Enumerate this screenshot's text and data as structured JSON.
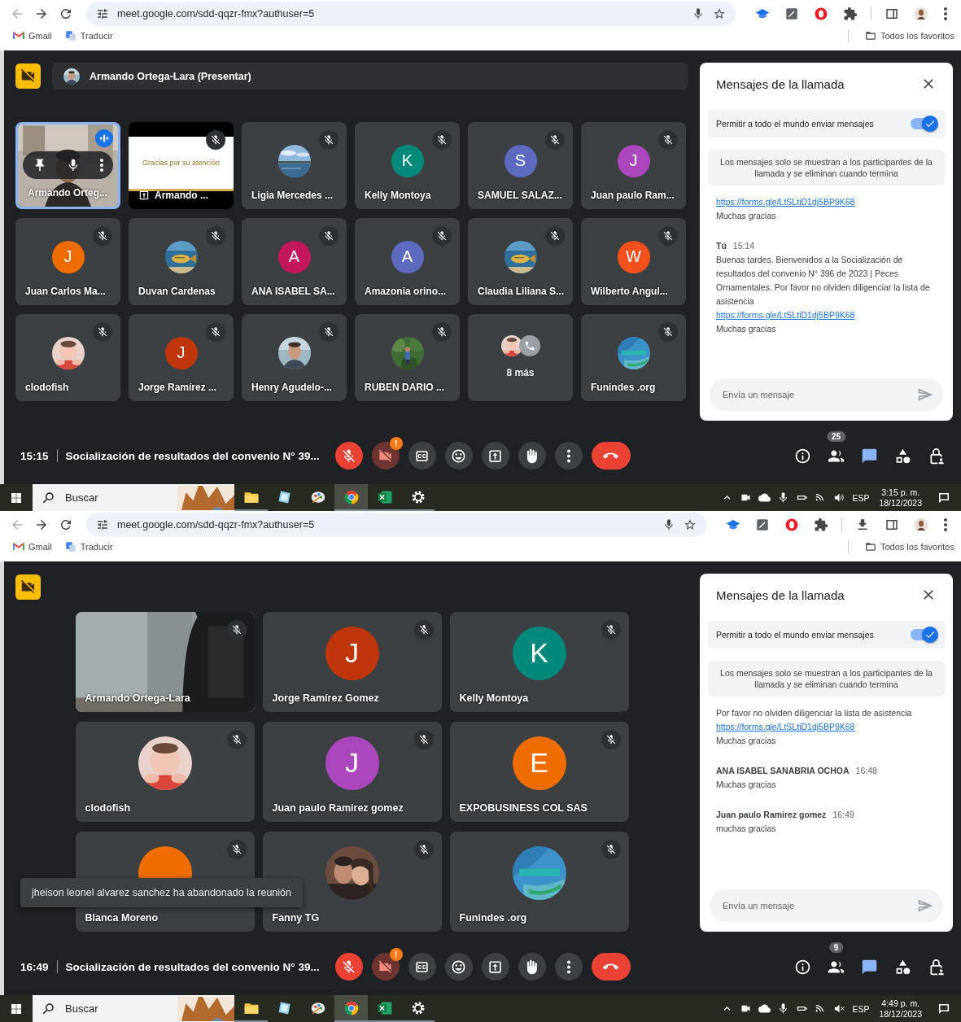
{
  "shots": [
    {
      "browser": {
        "url": "meet.google.com/sdd-qqzr-fmx?authuser=5",
        "download_shown": false,
        "bookmarks": [
          {
            "kind": "gmail",
            "label": "Gmail"
          },
          {
            "kind": "translate",
            "label": "Traducir"
          }
        ],
        "all_bookmarks": "Todos los favoritos"
      },
      "meet": {
        "presenter_bar": {
          "label": "Armando Ortega-Lara (Presentar)"
        },
        "tiles": [
          {
            "kind": "video",
            "name": "Armando Orteg...",
            "muted": false,
            "speaking": true,
            "hovered": true
          },
          {
            "kind": "presentation",
            "name": "Armando ...",
            "slide_text": "Gracias por su atención",
            "muted": true,
            "speaking": false,
            "hovered": false
          },
          {
            "name": "Ligia Mercedes ...",
            "muted": true,
            "speaking": false,
            "hovered": false
          },
          {
            "kind": "avatar",
            "name": "Kelly Montoya",
            "letter": "K",
            "color": "#00897b",
            "muted": true,
            "speaking": false,
            "hovered": false
          },
          {
            "kind": "avatar",
            "name": "SAMUEL SALAZ...",
            "letter": "S",
            "color": "#5c6bc0",
            "muted": true,
            "speaking": false,
            "hovered": false
          },
          {
            "kind": "avatar",
            "name": "Juan paulo Ram...",
            "letter": "J",
            "color": "#ab47bc",
            "muted": true,
            "speaking": false,
            "hovered": false
          },
          {
            "kind": "avatar",
            "name": "Juan Carlos Ma...",
            "letter": "J",
            "color": "#ef6c00",
            "muted": true,
            "speaking": false,
            "hovered": false
          },
          {
            "name": "Duvan Cardenas",
            "muted": true,
            "speaking": false,
            "hovered": false
          },
          {
            "kind": "avatar",
            "name": "ANA ISABEL SA...",
            "letter": "A",
            "color": "#c2185b",
            "muted": true,
            "speaking": false,
            "hovered": false
          },
          {
            "kind": "avatar",
            "name": "Amazonia orino...",
            "letter": "A",
            "color": "#5c6bc0",
            "muted": true,
            "speaking": false,
            "hovered": false
          },
          {
            "name": "Claudia Liliana S...",
            "muted": true,
            "speaking": false,
            "hovered": false
          },
          {
            "kind": "avatar",
            "name": "Wilberto Angul...",
            "letter": "W",
            "color": "#f4511e",
            "muted": true,
            "speaking": false,
            "hovered": false
          },
          {
            "name": "clodofish",
            "muted": true,
            "speaking": false,
            "hovered": false
          },
          {
            "kind": "avatar",
            "name": "Jorge Ramírez ...",
            "letter": "J",
            "color": "#bf360c",
            "muted": true,
            "speaking": false,
            "hovered": false
          },
          {
            "name": "Henry Agudelo-...",
            "muted": true,
            "speaking": false,
            "hovered": false
          },
          {
            "name": "RUBEN DARIO ...",
            "muted": true,
            "speaking": false,
            "hovered": false
          },
          {
            "kind": "more",
            "name": "8 más",
            "muted": false,
            "speaking": false,
            "hovered": false
          },
          {
            "name": "Funindes .org",
            "muted": true,
            "speaking": false,
            "hovered": false
          }
        ],
        "chat": {
          "title": "Mensajes de la llamada",
          "allow": {
            "label": "Permitir a todo el mundo enviar mensajes",
            "on": true
          },
          "notice": "Los mensajes solo se muestran a los participantes de la llamada y se eliminan cuando termina",
          "messages": [
            {
              "lines": [
                {
                  "kind": "link",
                  "text": "https://forms.gle/LtSLtiD1dj5BP9K68"
                },
                {
                  "kind": "text",
                  "text": "Muchas gracias"
                }
              ]
            },
            {
              "sender": "Tú",
              "time": "15:14",
              "lines": [
                {
                  "kind": "text",
                  "text": "Buenas tardes. Bienvenidos a la Socialización de resultados del convenio N° 396 de 2023 | Peces Ornamentales. Por favor no olviden diligenciar la lista de asistencia"
                },
                {
                  "kind": "link",
                  "text": "https://forms.gle/LtSLtiD1dj5BP9K68"
                },
                {
                  "kind": "text",
                  "text": "Muchas gracias"
                }
              ]
            }
          ],
          "input": {
            "placeholder": "Envía un mensaje"
          }
        },
        "controls": {
          "time": "15:15",
          "title": "Socialización de resultados del convenio N° 39...",
          "mic_on": false,
          "camera_on": false,
          "camera_alert": "!",
          "people_count": "25",
          "chat_open": true
        }
      },
      "taskbar": {
        "search": {
          "placeholder": "Buscar"
        },
        "apps": [
          {
            "kind": "folder",
            "running": true,
            "active": false
          },
          {
            "kind": "notes",
            "running": false,
            "active": false
          },
          {
            "kind": "paint",
            "running": false,
            "active": false
          },
          {
            "kind": "chrome",
            "running": true,
            "active": true
          },
          {
            "kind": "excel",
            "running": true,
            "active": false
          },
          {
            "kind": "settings",
            "running": true,
            "active": false
          }
        ],
        "language": "ESP",
        "time": "3:15 p. m.",
        "date": "18/12/2023",
        "volume_muted": false
      }
    },
    {
      "browser": {
        "url": "meet.google.com/sdd-qqzr-fmx?authuser=5",
        "download_shown": true,
        "bookmarks": [
          {
            "kind": "gmail",
            "label": "Gmail"
          },
          {
            "kind": "translate",
            "label": "Traducir"
          }
        ],
        "all_bookmarks": "Todos los favoritos"
      },
      "meet": {
        "tiles": [
          {
            "kind": "video",
            "name": "Armando Ortega-Lara",
            "muted": true,
            "speaking": false,
            "hovered": false
          },
          {
            "kind": "avatar",
            "name": "Jorge Ramírez Gomez",
            "letter": "J",
            "color": "#bf360c",
            "muted": true,
            "speaking": false,
            "hovered": false
          },
          {
            "kind": "avatar",
            "name": "Kelly Montoya",
            "letter": "K",
            "color": "#00897b",
            "muted": true,
            "speaking": false,
            "hovered": false
          },
          {
            "name": "clodofish",
            "muted": true,
            "speaking": false,
            "hovered": false
          },
          {
            "kind": "avatar",
            "name": "Juan paulo Ramirez gomez",
            "letter": "J",
            "color": "#ab47bc",
            "muted": true,
            "speaking": false,
            "hovered": false
          },
          {
            "kind": "avatar",
            "name": "EXPOBUSINESS COL SAS",
            "letter": "E",
            "color": "#ef6c00",
            "muted": true,
            "speaking": false,
            "hovered": false
          },
          {
            "kind": "avatar",
            "name": "Blanca Moreno",
            "color": "#ef6c00",
            "muted": true,
            "speaking": false,
            "hovered": false
          },
          {
            "name": "Fanny TG",
            "muted": true,
            "speaking": false,
            "hovered": false
          },
          {
            "name": "Funindes .org",
            "muted": true,
            "speaking": false,
            "hovered": false
          }
        ],
        "toast": "jheison leonel alvarez sanchez ha abandonado la reunión",
        "chat": {
          "title": "Mensajes de la llamada",
          "allow": {
            "label": "Permitir a todo el mundo enviar mensajes",
            "on": true
          },
          "notice": "Los mensajes solo se muestran a los participantes de la llamada y se eliminan cuando termina",
          "messages": [
            {
              "lines": [
                {
                  "kind": "text",
                  "text": "Por favor no olviden diligenciar la lista de asistencia"
                },
                {
                  "kind": "link",
                  "text": "https://forms.gle/LtSLtiD1dj5BP9K68"
                },
                {
                  "kind": "text",
                  "text": "Muchas gracias"
                }
              ]
            },
            {
              "sender": "ANA ISABEL SANABRIA OCHOA",
              "time": "16:48",
              "lines": [
                {
                  "kind": "text",
                  "text": "Muchas gracias"
                }
              ]
            },
            {
              "sender": "Juan paulo Ramirez gomez",
              "time": "16:49",
              "lines": [
                {
                  "kind": "text",
                  "text": "muchas gracias"
                }
              ]
            }
          ],
          "input": {
            "placeholder": "Envía un mensaje"
          }
        },
        "controls": {
          "time": "16:49",
          "title": "Socialización de resultados del convenio N° 39...",
          "mic_on": false,
          "camera_on": false,
          "camera_alert": "!",
          "people_count": "9",
          "chat_open": true
        }
      },
      "taskbar": {
        "search": {
          "placeholder": "Buscar"
        },
        "apps": [
          {
            "kind": "folder",
            "running": true,
            "active": false
          },
          {
            "kind": "notes",
            "running": false,
            "active": false
          },
          {
            "kind": "paint",
            "running": false,
            "active": false
          },
          {
            "kind": "chrome",
            "running": true,
            "active": true
          },
          {
            "kind": "excel",
            "running": true,
            "active": false
          },
          {
            "kind": "settings",
            "running": true,
            "active": false
          }
        ],
        "language": "ESP",
        "time": "4:49 p. m.",
        "date": "18/12/2023",
        "volume_muted": true
      }
    }
  ]
}
